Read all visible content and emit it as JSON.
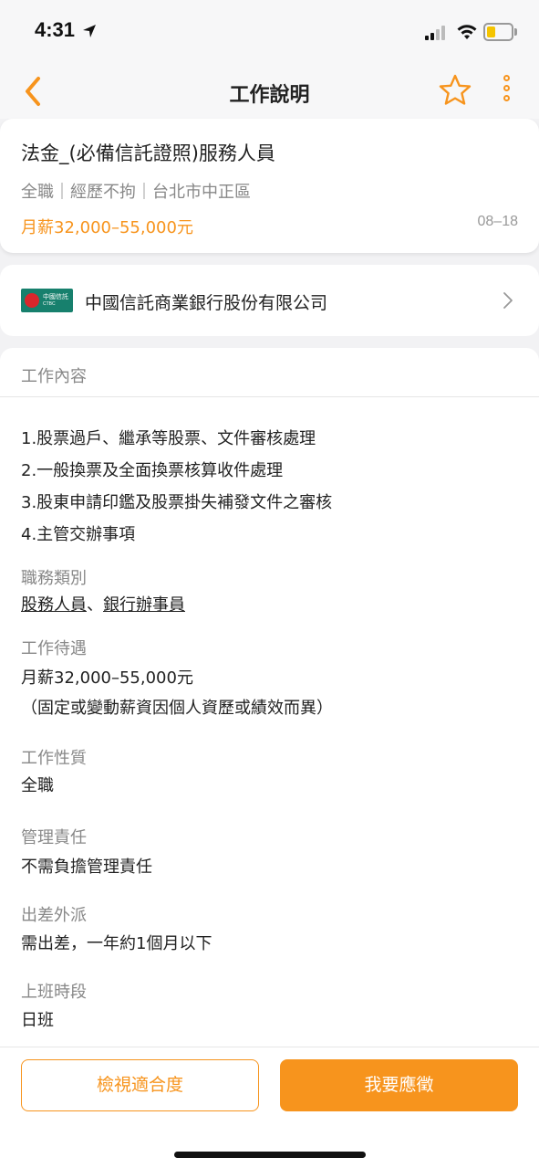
{
  "status_bar": {
    "time": "4:31"
  },
  "nav": {
    "title": "工作說明",
    "back_icon": "chevron-left-icon",
    "favorite_icon": "star-icon",
    "more_icon": "more-vertical-icon"
  },
  "job": {
    "title": "法金_(必備信託證照)服務人員",
    "meta": "全職｜經歷不拘｜台北市中正區",
    "salary": "月薪32,000–55,000元",
    "date": "08–18"
  },
  "company": {
    "logo_text_1": "中國信託",
    "logo_text_2": "CTBC",
    "name": "中國信託商業銀行股份有限公司"
  },
  "details": {
    "section_title": "工作內容",
    "description": [
      "1.股票過戶、繼承等股票、文件審核處理",
      "2.一般換票及全面換票核算收件處理",
      "3.股東申請印鑑及股票掛失補發文件之審核",
      "4.主管交辦事項"
    ],
    "category_label": "職務類別",
    "category_links": [
      "股務人員",
      "銀行辦事員"
    ],
    "category_sep": "、",
    "pay_label": "工作待遇",
    "pay_value": "月薪32,000–55,000元",
    "pay_note": "（固定或變動薪資因個人資歷或績效而異）",
    "type_label": "工作性質",
    "type_value": "全職",
    "mgmt_label": "管理責任",
    "mgmt_value": "不需負擔管理責任",
    "travel_label": "出差外派",
    "travel_value": "需出差，一年約1個月以下",
    "shift_label": "上班時段",
    "shift_value": "日班"
  },
  "actions": {
    "match_label": "檢視適合度",
    "apply_label": "我要應徵"
  },
  "colors": {
    "accent": "#f7941d",
    "logo_bg": "#17806d"
  }
}
